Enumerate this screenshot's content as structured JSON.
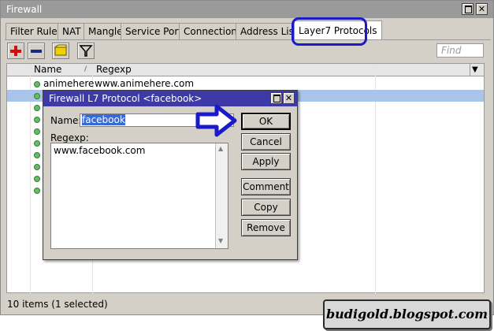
{
  "window": {
    "title": "Firewall"
  },
  "tabs": [
    {
      "label": "Filter Rules"
    },
    {
      "label": "NAT"
    },
    {
      "label": "Mangle"
    },
    {
      "label": "Service Ports"
    },
    {
      "label": "Connections"
    },
    {
      "label": "Address Lists"
    },
    {
      "label": "Layer7 Protocols"
    }
  ],
  "active_tab": "Layer7 Protocols",
  "toolbar": {
    "add_icon": "plus-icon",
    "remove_icon": "minus-icon",
    "comment_icon": "note-icon",
    "filter_icon": "funnel-icon",
    "find_placeholder": "Find"
  },
  "table": {
    "columns": [
      "Name",
      "Regexp"
    ],
    "rows": [
      {
        "name": "animehere",
        "regexp": "www.animehere.com",
        "selected": false
      },
      {
        "name": "",
        "regexp": "",
        "selected": true
      },
      {
        "name": "",
        "regexp": "",
        "selected": false
      },
      {
        "name": "",
        "regexp": "",
        "selected": false
      },
      {
        "name": "",
        "regexp": "",
        "selected": false
      },
      {
        "name": "",
        "regexp": "",
        "selected": false
      },
      {
        "name": "",
        "regexp": "",
        "selected": false
      },
      {
        "name": "",
        "regexp": "",
        "selected": false
      },
      {
        "name": "",
        "regexp": "",
        "selected": false
      },
      {
        "name": "",
        "regexp": "",
        "selected": false
      }
    ]
  },
  "status": "10 items (1 selected)",
  "dialog": {
    "title": "Firewall L7 Protocol <facebook>",
    "name_label": "Name:",
    "name_value": "facebook",
    "regexp_label": "Regexp:",
    "regexp_value": "www.facebook.com",
    "buttons": {
      "ok": "OK",
      "cancel": "Cancel",
      "apply": "Apply",
      "comment": "Comment",
      "copy": "Copy",
      "remove": "Remove"
    }
  },
  "watermark": "budigold.blogspot.com",
  "colors": {
    "selected_row": "#a8c4ea",
    "dialog_title": "#3d3aa8",
    "highlight": "#1a1ac8",
    "status_dot": "#60c060"
  }
}
